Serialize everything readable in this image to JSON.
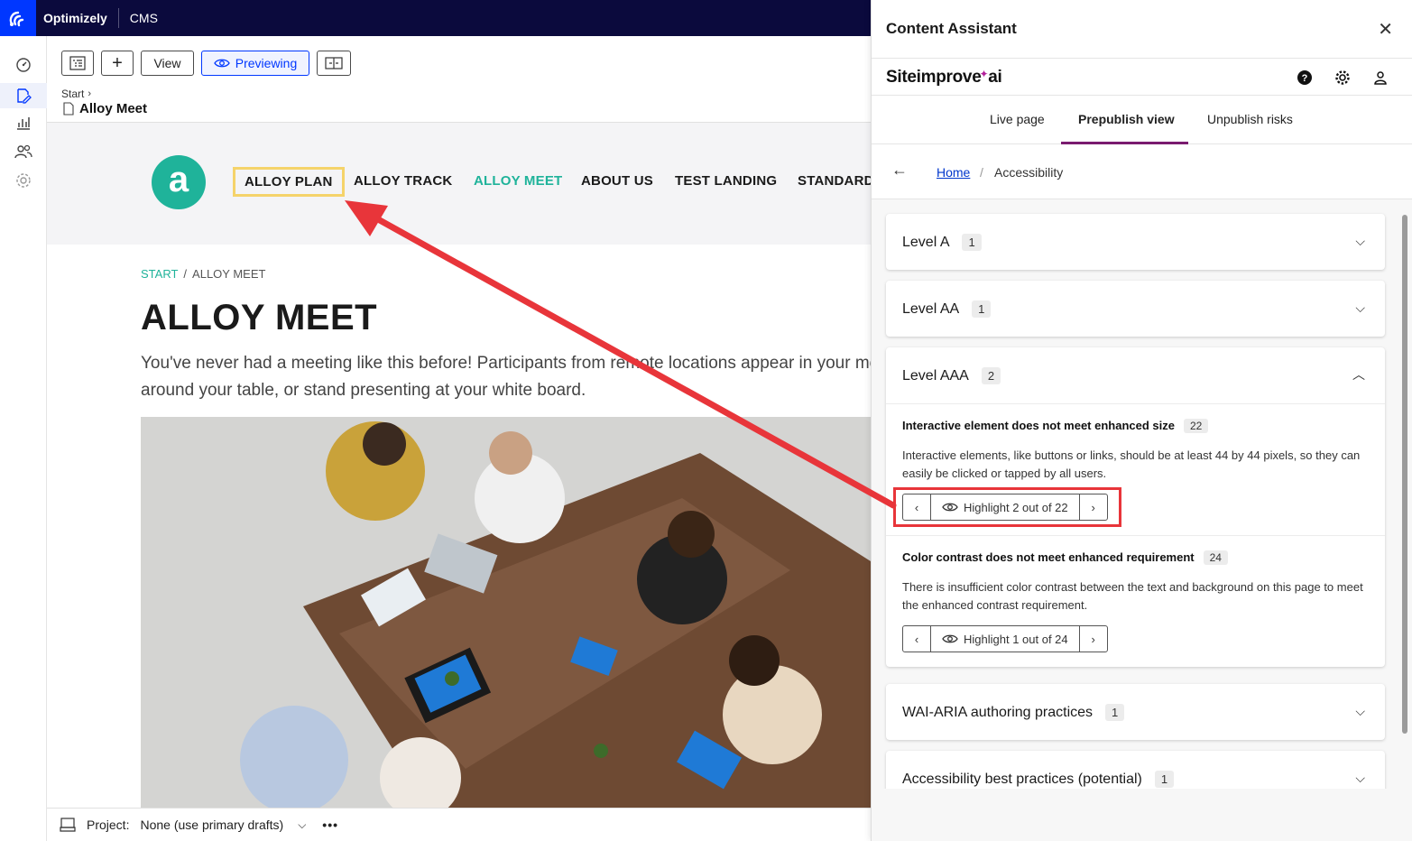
{
  "topbar": {
    "brand": "Optimizely",
    "product": "CMS"
  },
  "toolbar": {
    "view_label": "View",
    "previewing_label": "Previewing",
    "breadcrumb_start": "Start",
    "page_title": "Alloy Meet"
  },
  "site": {
    "logo_letter": "a",
    "nav": [
      "ALLOY PLAN",
      "ALLOY TRACK",
      "ALLOY MEET",
      "ABOUT US",
      "TEST LANDING",
      "STANDARD"
    ],
    "breadcrumb": [
      "START",
      "/",
      "ALLOY MEET"
    ],
    "heading": "ALLOY MEET",
    "intro_line1": "You've never had a meeting like this before! Participants from remote locations appear in your me",
    "intro_line2": "around your table, or stand presenting at your white board."
  },
  "bottombar": {
    "project_label": "Project:",
    "project_value": "None (use primary drafts)"
  },
  "panel": {
    "title": "Content Assistant",
    "siteimprove_brand": "Siteimprove",
    "siteimprove_suffix": "ai",
    "tabs": [
      "Live page",
      "Prepublish view",
      "Unpublish risks"
    ],
    "active_tab": "Prepublish view",
    "breadcrumb_home": "Home",
    "breadcrumb_current": "Accessibility",
    "levels": [
      {
        "name": "Level A",
        "count": "1",
        "expanded": false
      },
      {
        "name": "Level AA",
        "count": "1",
        "expanded": false
      },
      {
        "name": "Level AAA",
        "count": "2",
        "expanded": true
      },
      {
        "name": "WAI-ARIA authoring practices",
        "count": "1",
        "expanded": false
      },
      {
        "name": "Accessibility best practices (potential)",
        "count": "1",
        "expanded": false
      }
    ],
    "issues": [
      {
        "title": "Interactive element does not meet enhanced size",
        "count": "22",
        "desc": "Interactive elements, like buttons or links, should be at least 44 by 44 pixels, so they can easily be clicked or tapped by all users.",
        "highlight": "Highlight 2 out of 22"
      },
      {
        "title": "Color contrast does not meet enhanced requirement",
        "count": "24",
        "desc": "There is insufficient color contrast between the text and background on this page to meet the enhanced contrast requirement.",
        "highlight": "Highlight 1 out of 24"
      }
    ]
  },
  "colors": {
    "accent": "#0037ff",
    "topbar": "#0b0a3d",
    "site_green": "#1fb39a",
    "tab_underline": "#7a1b6f",
    "annotation_red": "#e8353a",
    "nav_highlight": "#f5d36a"
  },
  "icons": [
    "optimizely-logo-icon",
    "dashboard-icon",
    "edit-icon",
    "analytics-icon",
    "users-icon",
    "settings-icon",
    "tree-icon",
    "plus-icon",
    "eye-icon",
    "compare-icon",
    "page-icon",
    "close-icon",
    "help-icon",
    "gear-icon",
    "user-icon",
    "back-arrow-icon",
    "chevron-down-icon",
    "chevron-up-icon",
    "chevron-left-icon",
    "chevron-right-icon",
    "project-icon",
    "more-icon"
  ]
}
